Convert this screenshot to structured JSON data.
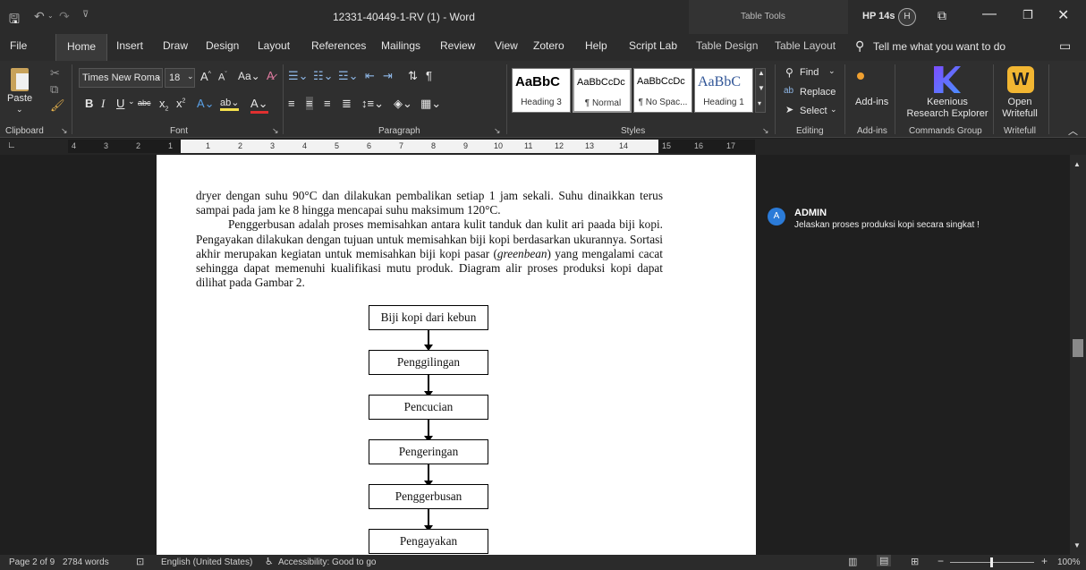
{
  "titlebar": {
    "doc_title": "12331-40449-1-RV (1)  -  Word",
    "context": "Table Tools",
    "device": "HP 14s",
    "user_initial": "H"
  },
  "tabs": [
    "File",
    "Home",
    "Insert",
    "Draw",
    "Design",
    "Layout",
    "References",
    "Mailings",
    "Review",
    "View",
    "Zotero",
    "Help",
    "Script Lab",
    "Table Design",
    "Table Layout"
  ],
  "tell_me": "Tell me what you want to do",
  "ribbon": {
    "clipboard": {
      "paste": "Paste",
      "label": "Clipboard"
    },
    "font": {
      "name": "Times New Roma",
      "size": "18",
      "label": "Font"
    },
    "paragraph": {
      "label": "Paragraph"
    },
    "styles": {
      "label": "Styles",
      "items": [
        {
          "preview": "AaBbC",
          "name": "Heading 3"
        },
        {
          "preview": "AaBbCcDc",
          "name": "¶ Normal"
        },
        {
          "preview": "AaBbCcDc",
          "name": "¶ No Spac..."
        },
        {
          "preview": "AaBbC",
          "name": "Heading 1"
        }
      ]
    },
    "editing": {
      "find": "Find",
      "replace": "Replace",
      "select": "Select",
      "label": "Editing"
    },
    "addins": {
      "button": "Add-ins",
      "label": "Add-ins"
    },
    "keenious": {
      "button": "Keenious Research Explorer",
      "label": "Commands Group"
    },
    "writefull": {
      "button": "Open Writefull",
      "label": "Writefull"
    }
  },
  "ruler": [
    "4",
    "3",
    "2",
    "1",
    "1",
    "2",
    "3",
    "4",
    "5",
    "6",
    "7",
    "8",
    "9",
    "10",
    "11",
    "12",
    "13",
    "14",
    "15",
    "16",
    "17"
  ],
  "document": {
    "para1": "dryer dengan suhu 90°C dan dilakukan pembalikan setiap 1 jam sekali. Suhu dinaikkan terus sampai pada jam ke 8 hingga mencapai suhu maksimum 120°C.",
    "para2_a": "Penggerbusan adalah proses memisahkan antara kulit tanduk dan kulit ari paada biji kopi. Pengayakan dilakukan dengan tujuan untuk memisahkan biji kopi berdasarkan ukurannya. Sortasi akhir merupakan kegiatan untuk memisahkan biji kopi pasar (",
    "para2_italic": "greenbean",
    "para2_b": ") yang mengalami cacat sehingga dapat memenuhi kualifikasi mutu produk. Diagram alir proses produksi kopi dapat dilihat pada Gambar 2.",
    "flow": [
      "Biji kopi dari kebun",
      "Penggilingan",
      "Pencucian",
      "Pengeringan",
      "Penggerbusan",
      "Pengayakan"
    ]
  },
  "comment": {
    "initial": "A",
    "author": "ADMIN",
    "text": "Jelaskan proses produksi kopi secara singkat !"
  },
  "status": {
    "page": "Page 2 of 9",
    "words": "2784 words",
    "language": "English (United States)",
    "accessibility": "Accessibility: Good to go",
    "zoom": "100%"
  },
  "colors": {
    "accent": "#2b579a",
    "comment_avatar": "#2b7bd8"
  }
}
